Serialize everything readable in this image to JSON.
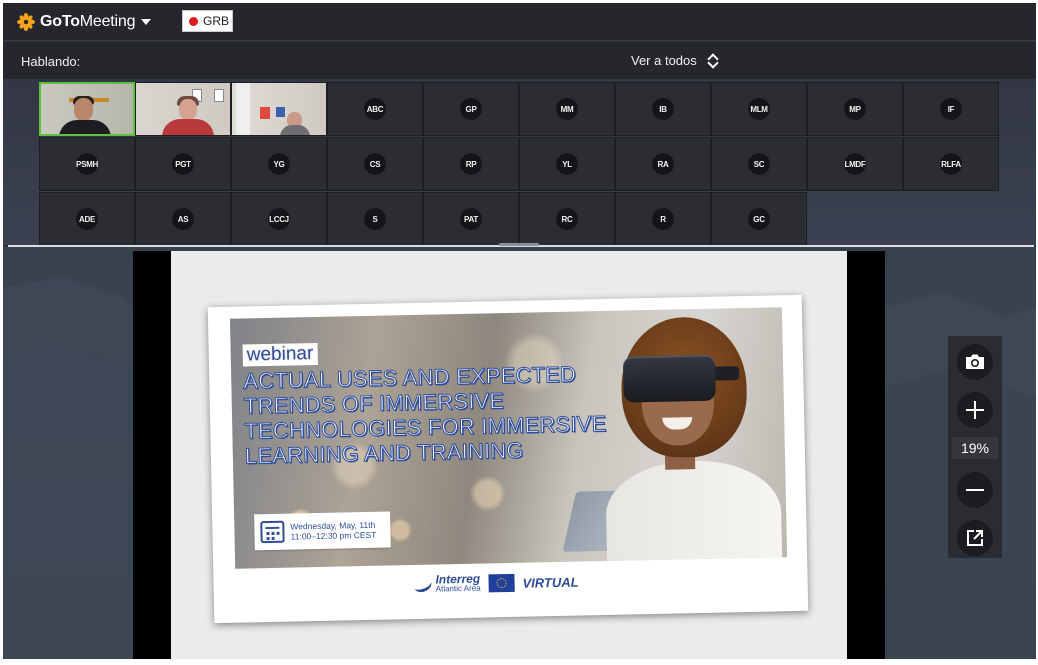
{
  "app": {
    "brand_prefix": "GoTo",
    "brand_suffix": "Meeting",
    "recording_label": "GRB",
    "recording_color": "#e01a1a",
    "accent_color": "#5cc13f"
  },
  "speaking_bar": {
    "label": "Hablando:",
    "view_option": "Ver a todos"
  },
  "participants": [
    {
      "initials": "",
      "video": true,
      "active": true
    },
    {
      "initials": "",
      "video": true,
      "active": false
    },
    {
      "initials": "",
      "video": true,
      "active": false
    },
    {
      "initials": "ABC"
    },
    {
      "initials": "GP"
    },
    {
      "initials": "MM"
    },
    {
      "initials": "IB"
    },
    {
      "initials": "MLM"
    },
    {
      "initials": "MP"
    },
    {
      "initials": "IF"
    },
    {
      "initials": "PSMH"
    },
    {
      "initials": "PGT"
    },
    {
      "initials": "YG"
    },
    {
      "initials": "CS"
    },
    {
      "initials": "RP"
    },
    {
      "initials": "YL"
    },
    {
      "initials": "RA"
    },
    {
      "initials": "SC"
    },
    {
      "initials": "LMDF"
    },
    {
      "initials": "RLFA"
    },
    {
      "initials": "ADE"
    },
    {
      "initials": "AS"
    },
    {
      "initials": "LCCJ"
    },
    {
      "initials": "S"
    },
    {
      "initials": "PAT"
    },
    {
      "initials": "RC"
    },
    {
      "initials": "R"
    },
    {
      "initials": "GC"
    }
  ],
  "slide": {
    "kicker": "webinar",
    "title_lines": [
      "ACTUAL USES AND EXPECTED",
      "TRENDS OF IMMERSIVE",
      "TECHNOLOGIES FOR IMMERSIVE",
      "LEARNING AND TRAINING"
    ],
    "date_line1": "Wednesday, May, 11th",
    "date_line2": "11:00–12:30 pm CEST",
    "logo_interreg": "Interreg",
    "logo_area": "Atlantic Area",
    "logo_virtual": "VIRTUAL",
    "brand_color": "#2e4d9a"
  },
  "zoom": {
    "level": "19%",
    "buttons": [
      "camera-icon",
      "zoom-in-icon",
      "zoom-out-icon",
      "popout-icon"
    ]
  }
}
